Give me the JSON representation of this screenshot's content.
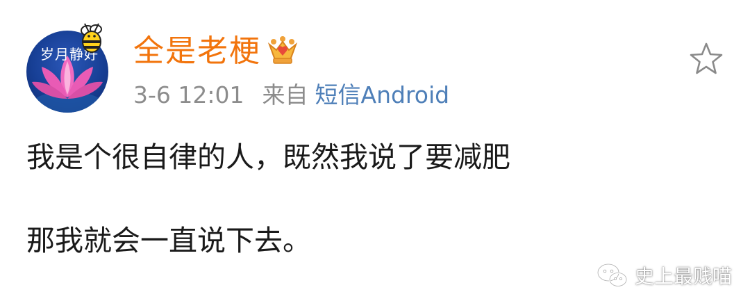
{
  "user": {
    "name": "全是老梗",
    "avatar_text": "岁月静好",
    "badge_icon": "crown-icon"
  },
  "post": {
    "time": "3-6 12:01",
    "from_label": "来自",
    "source": "短信Android",
    "lines": [
      "我是个很自律的人，既然我说了要减肥",
      "那我就会一直说下去。"
    ]
  },
  "actions": {
    "favorite_icon": "star-outline-icon"
  },
  "watermark": {
    "text": "史上最贱喵",
    "icon": "wechat-icon"
  },
  "colors": {
    "username": "#f2740c",
    "source_link": "#4e7fb8",
    "meta_gray": "#8c8c8c",
    "text": "#1a1a1a"
  }
}
